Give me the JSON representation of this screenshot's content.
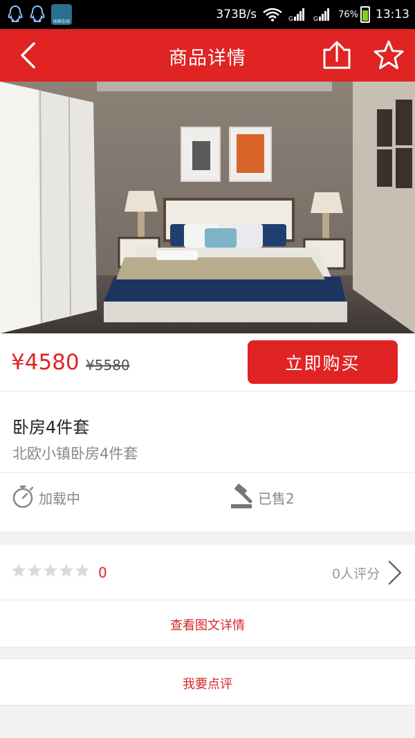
{
  "status_bar": {
    "network_speed": "373B/s",
    "battery_percent": "76%",
    "time": "13:13",
    "app_icon_text": "国美在线"
  },
  "header": {
    "title": "商品详情",
    "back_icon": "chevron-left-icon",
    "share_icon": "share-icon",
    "favorite_icon": "star-outline-icon"
  },
  "product": {
    "image_alt": "bedroom-furniture-photo",
    "price_current": "¥4580",
    "price_original": "¥5580",
    "buy_label": "立即购买",
    "name": "卧房4件套",
    "subtitle": "北欧小镇卧房4件套",
    "loading_text": "加载中",
    "sold_text": "已售2"
  },
  "rating": {
    "stars_filled": 0,
    "stars_total": 5,
    "score": "0",
    "review_count_text": "0人评分"
  },
  "links": {
    "detail_label": "查看图文详情",
    "review_label": "我要点评"
  },
  "colors": {
    "accent": "#e02424",
    "status_bar": "#000000",
    "background": "#f2f2f2"
  }
}
